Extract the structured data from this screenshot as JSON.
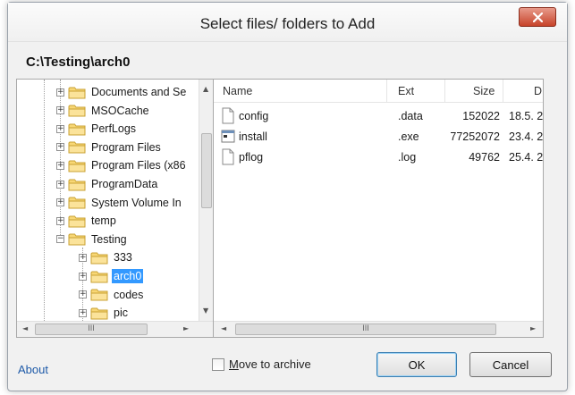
{
  "dialog": {
    "title": "Select files/ folders to Add",
    "close_glyph": "✕"
  },
  "path": "C:\\Testing\\arch0",
  "tree": {
    "items": [
      {
        "label": "Documents and Se",
        "level": 0,
        "expander": "+"
      },
      {
        "label": "MSOCache",
        "level": 0,
        "expander": "+"
      },
      {
        "label": "PerfLogs",
        "level": 0,
        "expander": "+"
      },
      {
        "label": "Program Files",
        "level": 0,
        "expander": "+"
      },
      {
        "label": "Program Files (x86",
        "level": 0,
        "expander": "+"
      },
      {
        "label": "ProgramData",
        "level": 0,
        "expander": "+"
      },
      {
        "label": "System Volume In",
        "level": 0,
        "expander": "+"
      },
      {
        "label": "temp",
        "level": 0,
        "expander": "+"
      },
      {
        "label": "Testing",
        "level": 0,
        "expander": "−"
      },
      {
        "label": "333",
        "level": 1,
        "expander": "+"
      },
      {
        "label": "arch0",
        "level": 1,
        "expander": "+",
        "selected": true
      },
      {
        "label": "codes",
        "level": 1,
        "expander": "+"
      },
      {
        "label": "pic",
        "level": 1,
        "expander": "+"
      }
    ]
  },
  "files": {
    "columns": {
      "name": "Name",
      "ext": "Ext",
      "size": "Size",
      "date": "D"
    },
    "rows": [
      {
        "name": "config",
        "ext": ".data",
        "size": "152022",
        "date": "18.5. 2",
        "icon": "document-icon"
      },
      {
        "name": "install",
        "ext": ".exe",
        "size": "77252072",
        "date": "23.4. 2",
        "icon": "executable-icon"
      },
      {
        "name": "pflog",
        "ext": ".log",
        "size": "49762",
        "date": "25.4. 2",
        "icon": "document-icon"
      }
    ]
  },
  "scroll": {
    "up": "▲",
    "down": "▼",
    "left": "◄",
    "right": "►",
    "thumb_grip": "III"
  },
  "footer": {
    "about": "About",
    "move_to_archive": "Move to archive",
    "ok": "OK",
    "cancel": "Cancel"
  },
  "colors": {
    "accent_selection": "#3399ff",
    "link": "#1e5aa8",
    "close_button": "#c7432a"
  }
}
